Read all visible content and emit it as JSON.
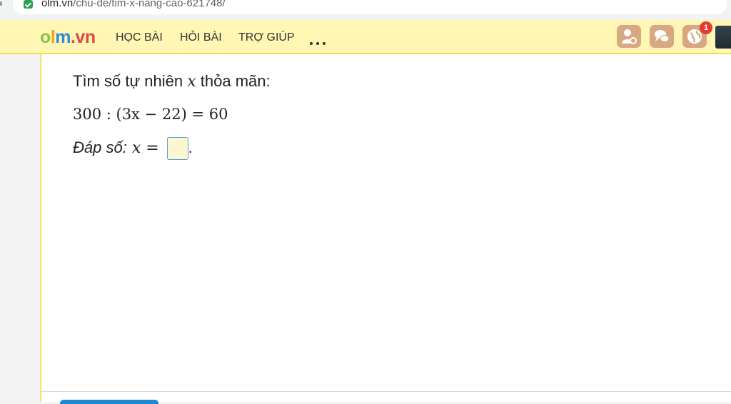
{
  "browser": {
    "url_host": "olm.vn",
    "url_path": "/chu-de/tim-x-nang-cao-621748/"
  },
  "header": {
    "logo": {
      "part1": "o",
      "part2": "l",
      "part3": "m",
      "part4": ".vn"
    },
    "nav": [
      "HỌC BÀI",
      "HỎI BÀI",
      "TRỢ GIÚP"
    ],
    "more_icon": "ellipsis-icon",
    "icons": [
      "user-icon",
      "chat-icon",
      "globe-icon"
    ],
    "notification_count": "1",
    "colors": {
      "header_bg": "#fff7b3",
      "icon_bg": "#d8a882",
      "badge": "#e53935"
    }
  },
  "problem": {
    "prompt_before": "Tìm số tự nhiên ",
    "prompt_var": "x",
    "prompt_after": " thỏa mãn:",
    "equation": "300 : (3x − 22) = 60",
    "answer_label": "Đáp số:",
    "answer_eq": " x = ",
    "answer_value": "",
    "answer_suffix": "."
  }
}
